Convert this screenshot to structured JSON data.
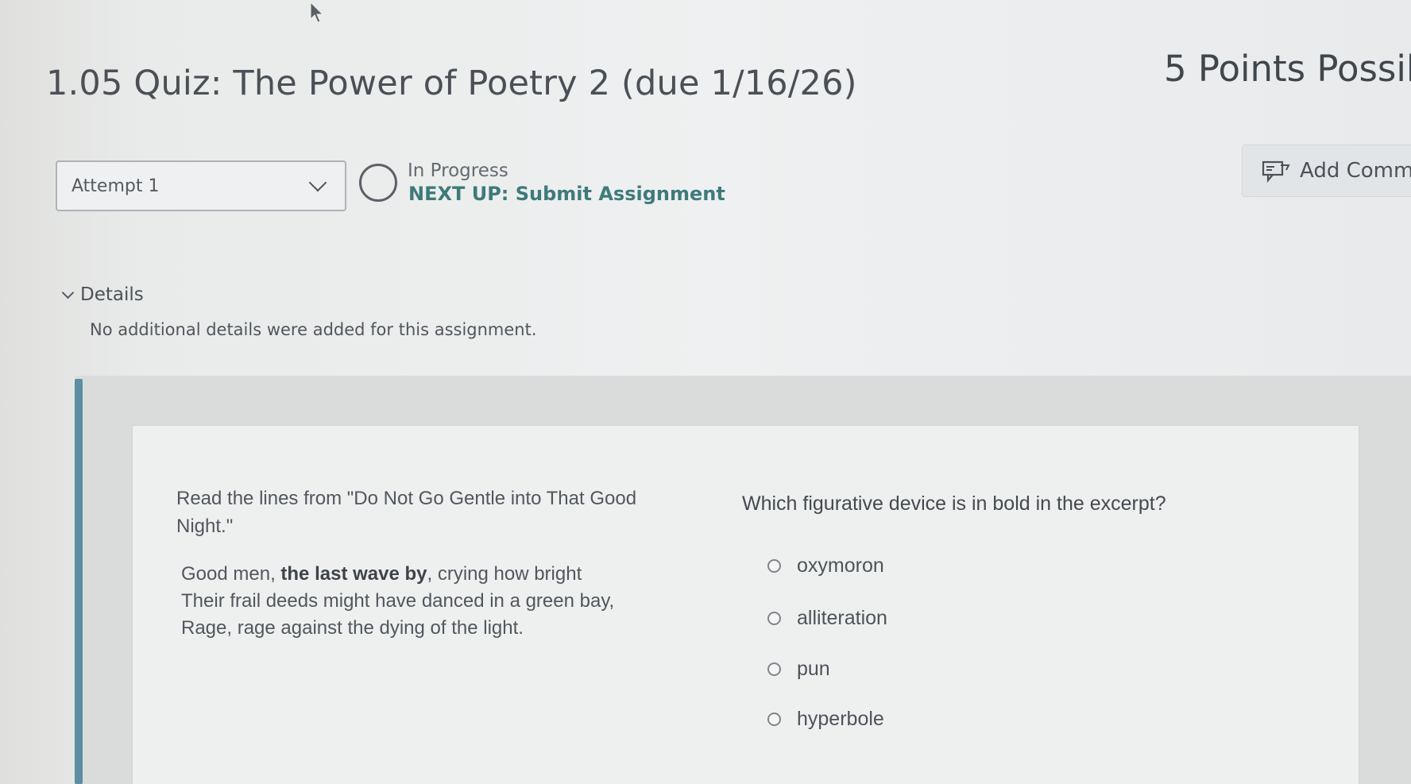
{
  "header": {
    "title": "1.05 Quiz: The Power of Poetry 2 (due 1/16/26)",
    "points": "5 Points Possil"
  },
  "attempt": {
    "selected": "Attempt 1"
  },
  "status": {
    "state": "In Progress",
    "next_up": "NEXT UP: Submit Assignment"
  },
  "add_comment": {
    "label": "Add Comm",
    "icon": "comment-icon"
  },
  "details": {
    "label": "Details",
    "text": "No additional details were added for this assignment."
  },
  "quiz": {
    "passage_intro": "Read the lines from \"Do Not Go Gentle into That Good Night.\"",
    "poem": {
      "line1_pre": "Good men, ",
      "line1_bold": "the last wave by",
      "line1_post": ", crying how bright",
      "line2": "Their frail deeds might have danced in a green bay,",
      "line3": "Rage, rage against the dying of the light."
    },
    "question": "Which figurative device is in bold in the excerpt?",
    "options": [
      {
        "label": "oxymoron"
      },
      {
        "label": "alliteration"
      },
      {
        "label": "pun"
      },
      {
        "label": "hyperbole"
      }
    ]
  },
  "colors": {
    "accent_bar": "#5d8ea3",
    "next_up": "#3f7a7a"
  }
}
